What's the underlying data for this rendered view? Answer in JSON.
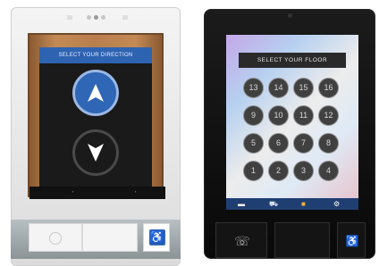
{
  "left_panel": {
    "header": "SELECT YOUR DIRECTION",
    "up_icon": "up-arrow-icon",
    "down_icon": "down-arrow-icon",
    "accent": "#2f66b5"
  },
  "right_panel": {
    "header": "SELECT YOUR FLOOR",
    "floors": [
      "13",
      "14",
      "15",
      "16",
      "9",
      "10",
      "11",
      "12",
      "5",
      "6",
      "7",
      "8",
      "1",
      "2",
      "3",
      "4"
    ],
    "nav_icons": [
      "minus-icon",
      "cart-icon",
      "layers-icon",
      "settings-icon"
    ],
    "nav_color": "#1f3f73"
  },
  "accessibility_icon": "wheelchair-icon",
  "intercom_icon": "phone-icon"
}
